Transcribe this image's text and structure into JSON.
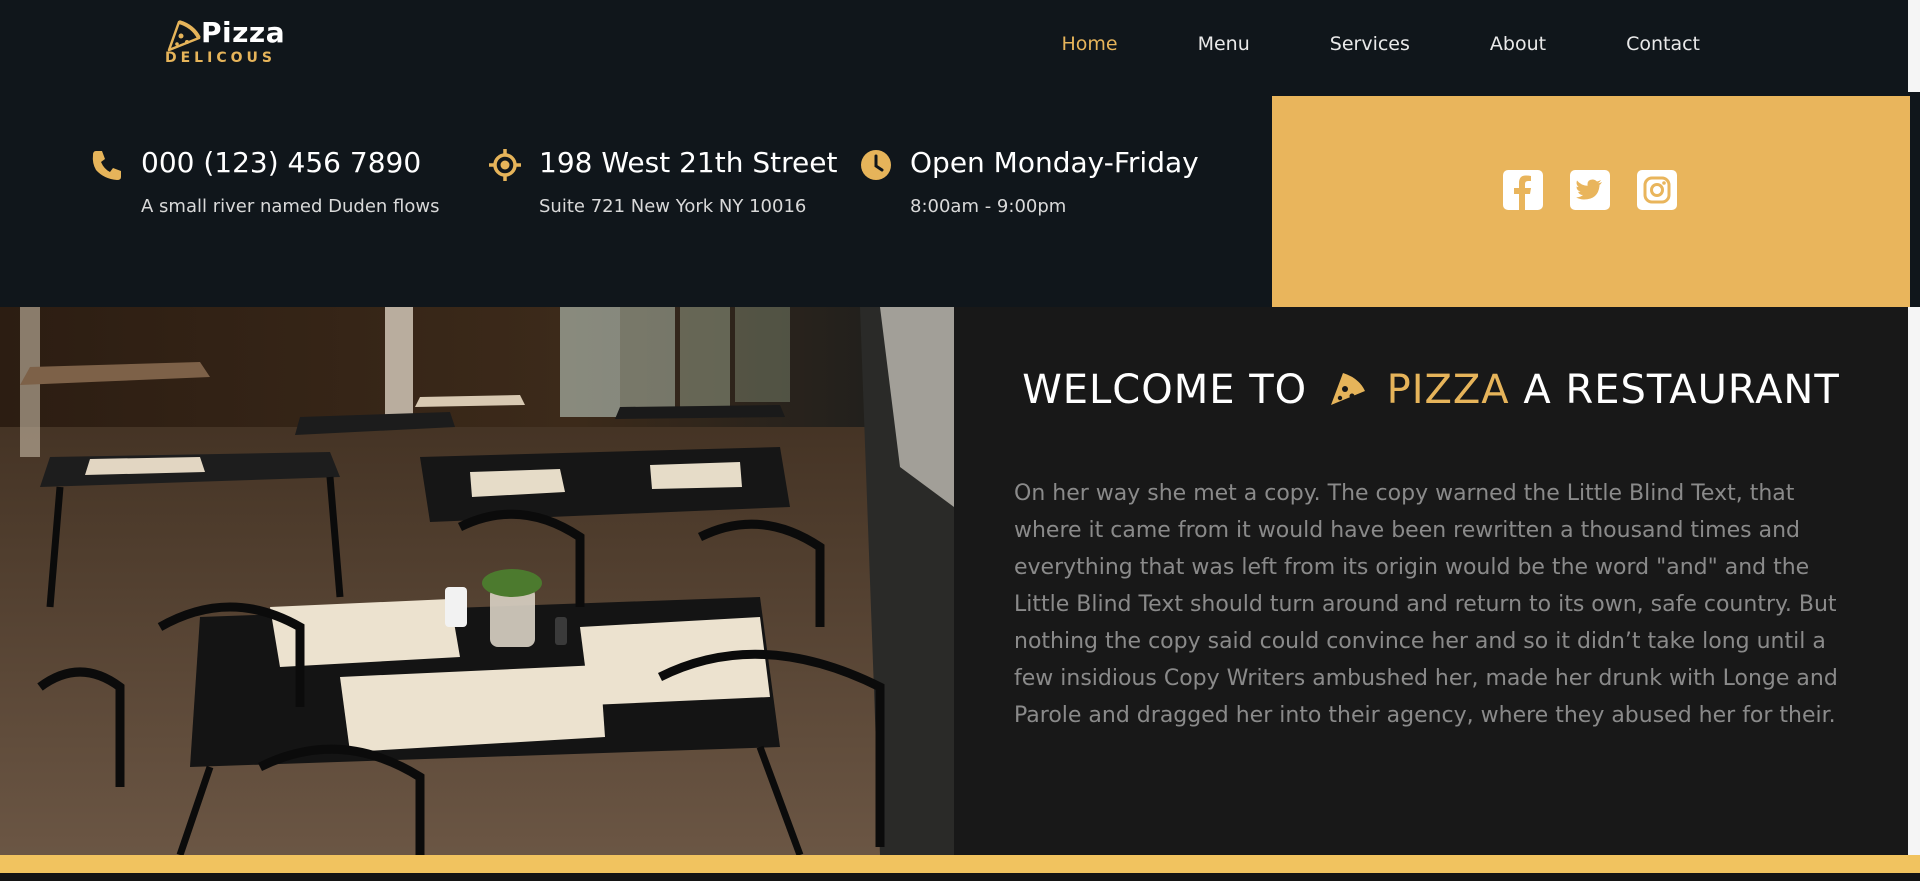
{
  "brand": {
    "name": "Pizza",
    "tagline": "DELICOUS",
    "accent_color": "#e6b45a"
  },
  "nav": {
    "items": [
      {
        "label": "Home",
        "active": true
      },
      {
        "label": "Menu",
        "active": false
      },
      {
        "label": "Services",
        "active": false
      },
      {
        "label": "About",
        "active": false
      },
      {
        "label": "Contact",
        "active": false
      }
    ]
  },
  "info": {
    "phone": {
      "icon": "phone-icon",
      "title": "000 (123) 456 7890",
      "subtitle": "A small river named Duden flows"
    },
    "address": {
      "icon": "location-icon",
      "title": "198 West 21th Street",
      "subtitle": "Suite 721 New York NY 10016"
    },
    "hours": {
      "icon": "clock-icon",
      "title": "Open Monday-Friday",
      "subtitle": "8:00am - 9:00pm"
    }
  },
  "social": {
    "icons": [
      "facebook-icon",
      "twitter-icon",
      "instagram-icon"
    ]
  },
  "hero": {
    "title_prefix": "WELCOME TO",
    "title_brand": "PIZZA",
    "title_suffix": "A RESTAURANT",
    "paragraph": "On her way she met a copy. The copy warned the Little Blind Text, that where it came from it would have been rewritten a thousand times and everything that was left from its origin would be the word \"and\" and the Little Blind Text should turn around and return to its own, safe country. But nothing the copy said could convince her and so it didn’t take long until a few insidious Copy Writers ambushed her, made her drunk with Longe and Parole and dragged her into their agency, where they abused her for their."
  }
}
